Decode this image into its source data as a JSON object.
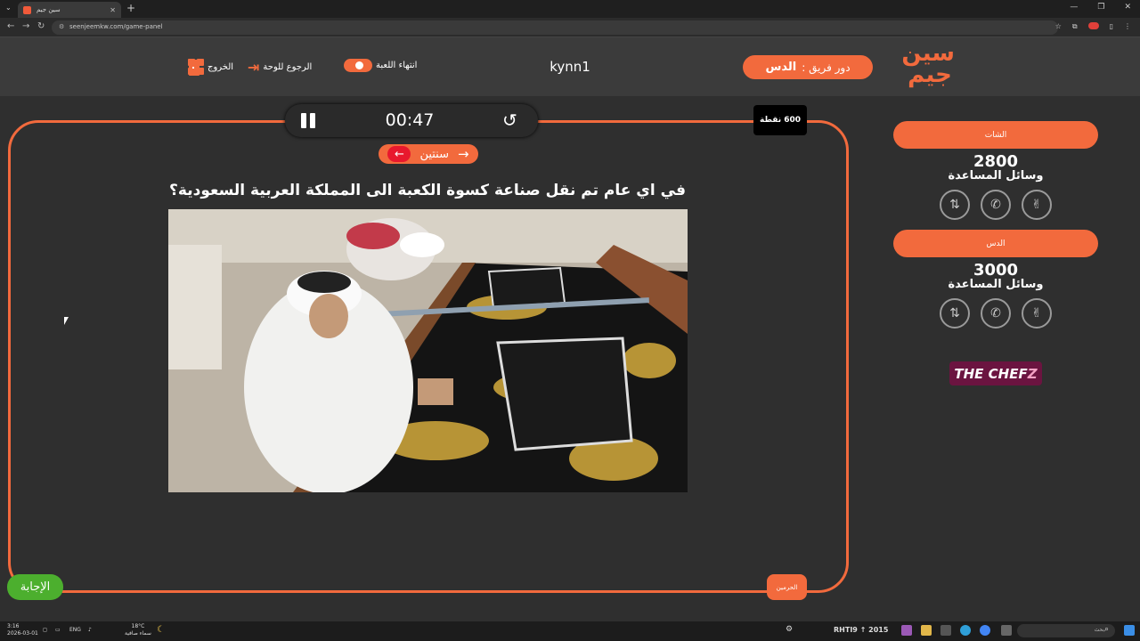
{
  "browser": {
    "tab_title": "سين جيم",
    "url": "seenjeemkw.com/game-panel"
  },
  "header": {
    "logo_text_line1": "سين",
    "logo_text_line2": "جيم",
    "turn_label": "دور فريق :",
    "turn_team": "الدس",
    "game_name": "kynn1",
    "end_game_label": "انتهاء اللعبة",
    "back_to_board_label": "الرجوع للوحة",
    "exit_label": "الخروج"
  },
  "question_panel": {
    "timer": "00:47",
    "points": "600 نقطة",
    "category": "سنتين",
    "question": "في اي عام تم نقل صناعة كسوة الكعبة الى المملكة العربية السعودية؟",
    "answer_label": "الإجابة",
    "tag_label": "الحرمين"
  },
  "teams": [
    {
      "name": "الشات",
      "score": "2800",
      "aids_label": "وسائل المساعدة"
    },
    {
      "name": "الدس",
      "score": "3000",
      "aids_label": "وسائل المساعدة"
    }
  ],
  "sponsor": {
    "part1": "THE CHEF",
    "part2": "Z"
  },
  "taskbar": {
    "time": "3:16",
    "date": "2026-03-01",
    "lang": "ENG",
    "weather_temp": "18°C",
    "weather_desc": "سماء صافية",
    "ticker": "RHTI9 ↑ 2015",
    "search_placeholder": "بحث"
  },
  "colors": {
    "accent": "#f26a3d",
    "answer": "#4caf2e",
    "category_arrow": "#e8182d",
    "background": "#2f2f2f"
  }
}
